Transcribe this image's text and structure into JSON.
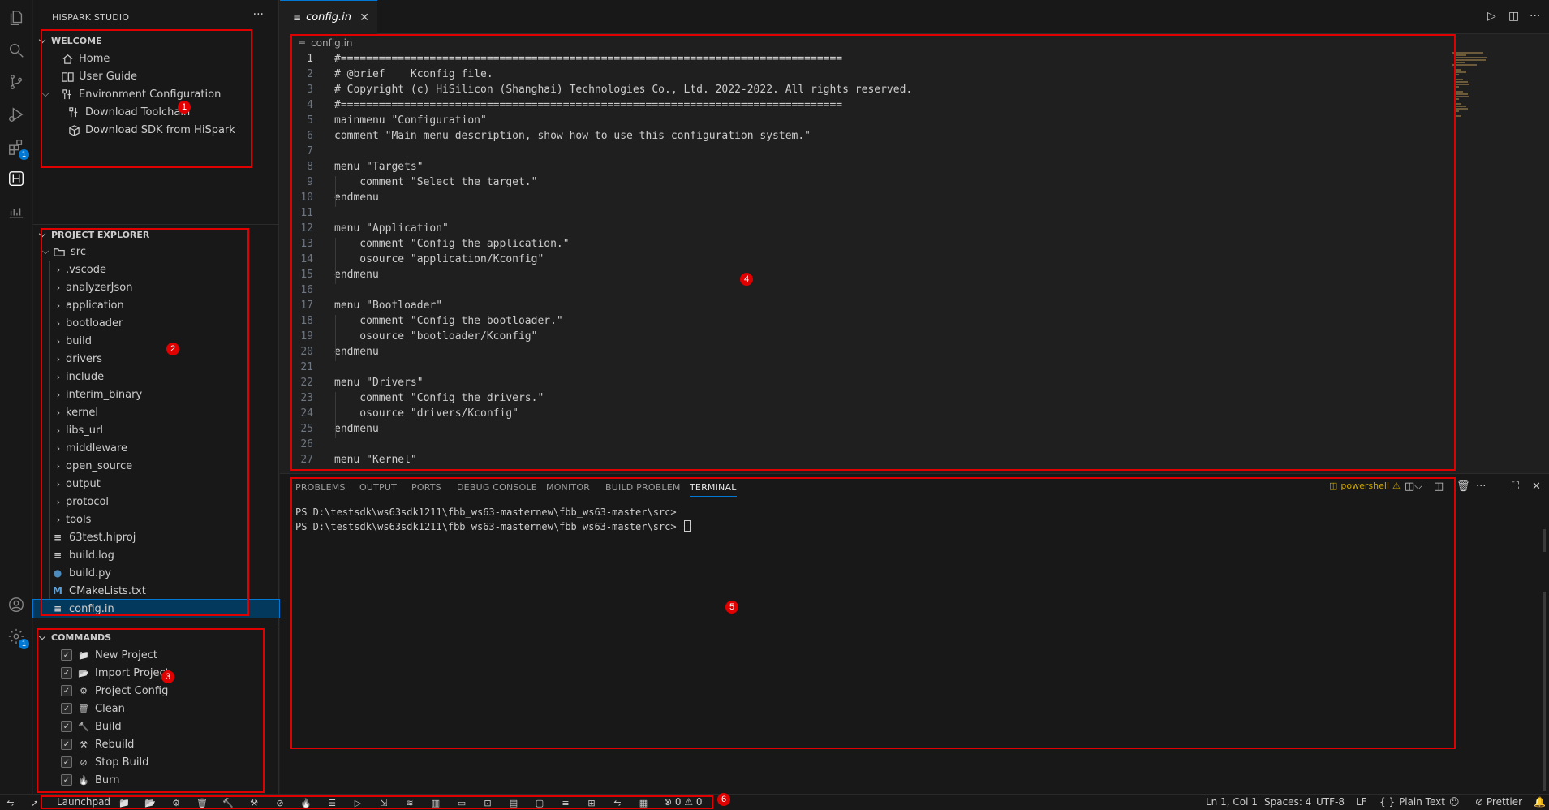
{
  "sidebar": {
    "title": "HISPARK STUDIO",
    "more": "···",
    "welcome": {
      "header": "WELCOME",
      "items": [
        {
          "label": "Home",
          "icon": "home-icon"
        },
        {
          "label": "User Guide",
          "icon": "book-icon"
        },
        {
          "label": "Environment Configuration",
          "icon": "tools-icon"
        },
        {
          "label": "Download Toolchain",
          "icon": "tools-icon"
        },
        {
          "label": "Download SDK from HiSpark",
          "icon": "box-icon"
        }
      ]
    },
    "explorer": {
      "header": "PROJECT EXPLORER",
      "root": "src",
      "folders": [
        ".vscode",
        "analyzerJson",
        "application",
        "bootloader",
        "build",
        "drivers",
        "include",
        "interim_binary",
        "kernel",
        "libs_url",
        "middleware",
        "open_source",
        "output",
        "protocol",
        "tools"
      ],
      "files": [
        {
          "label": "63test.hiproj",
          "icon": "lines"
        },
        {
          "label": "build.log",
          "icon": "lines"
        },
        {
          "label": "build.py",
          "icon": "python"
        },
        {
          "label": "CMakeLists.txt",
          "icon": "cmake"
        },
        {
          "label": "config.in",
          "icon": "lines"
        }
      ]
    },
    "commands": {
      "header": "COMMANDS",
      "items": [
        "New Project",
        "Import Project",
        "Project Config",
        "Clean",
        "Build",
        "Rebuild",
        "Stop Build",
        "Burn"
      ]
    }
  },
  "editor": {
    "tab_label": "config.in",
    "breadcrumb": "config.in",
    "lines": [
      "#===============================================================================",
      "# @brief    Kconfig file.",
      "# Copyright (c) HiSilicon (Shanghai) Technologies Co., Ltd. 2022-2022. All rights reserved.",
      "#===============================================================================",
      "mainmenu \"Configuration\"",
      "comment \"Main menu description, show how to use this configuration system.\"",
      "",
      "menu \"Targets\"",
      "    comment \"Select the target.\"",
      "endmenu",
      "",
      "menu \"Application\"",
      "    comment \"Config the application.\"",
      "    osource \"application/Kconfig\"",
      "endmenu",
      "",
      "menu \"Bootloader\"",
      "    comment \"Config the bootloader.\"",
      "    osource \"bootloader/Kconfig\"",
      "endmenu",
      "",
      "menu \"Drivers\"",
      "    comment \"Config the drivers.\"",
      "    osource \"drivers/Kconfig\"",
      "endmenu",
      "",
      "menu \"Kernel\""
    ]
  },
  "panel": {
    "tabs": [
      "PROBLEMS",
      "OUTPUT",
      "PORTS",
      "DEBUG CONSOLE",
      "MONITOR",
      "BUILD PROBLEM",
      "TERMINAL"
    ],
    "active_tab": "TERMINAL",
    "shell": "powershell",
    "terminal_lines": [
      "PS D:\\testsdk\\ws63sdk1211\\fbb_ws63-masternew\\fbb_ws63-master\\src> ",
      "PS D:\\testsdk\\ws63sdk1211\\fbb_ws63-masternew\\fbb_ws63-master\\src> "
    ]
  },
  "statusbar": {
    "launchpad": "Launchpad",
    "problems": "⊗ 0 ⚠ 0",
    "position": "Ln 1, Col 1",
    "spaces": "Spaces: 4",
    "encoding": "UTF-8",
    "eol": "LF",
    "language": "Plain Text",
    "prettier": "Prettier"
  },
  "annotations": [
    "1",
    "2",
    "3",
    "4",
    "5",
    "6"
  ],
  "badges": {
    "extensions": "1",
    "settings": "1"
  },
  "colors": {
    "accent": "#0078d4",
    "annotation": "#e00000",
    "warning": "#cca700"
  }
}
